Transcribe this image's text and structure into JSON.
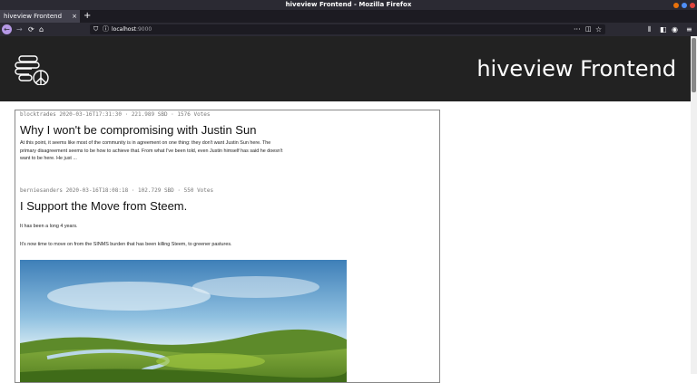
{
  "window": {
    "title": "hiveview Frontend - Mozilla Firefox"
  },
  "tab": {
    "label": "hiveview Frontend",
    "close": "×",
    "new_tab": "+"
  },
  "url_bar": {
    "host": "localhost",
    "port": ":9000"
  },
  "site": {
    "title": "hiveview Frontend"
  },
  "posts": [
    {
      "meta": "blocktrades 2020-03-16T17:31:30 · 221.989 SBD · 1576 Votes",
      "title": "Why I won't be compromising with Justin Sun",
      "excerpt": "At this point, it seems like most of the community is in agreement on one thing: they don't want Justin Sun here. The primary disagreement seems to be how to achieve that. From what I've been told, even Justin himself has said he doesn't want to be here. He just ..."
    },
    {
      "meta": "berniesanders 2020-03-16T18:08:18 · 102.729 SBD · 550 Votes",
      "title": "I Support the Move from Steem.",
      "line1": "It has been a long 4 years.",
      "line2": "It's now time to move on from the SINMS burden that has been killing Steem, to greener pastures."
    }
  ],
  "icons": [
    "back-icon",
    "forward-icon",
    "reload-icon",
    "home-icon",
    "shield-icon",
    "info-icon",
    "more-icon",
    "pocket-icon",
    "star-icon",
    "library-icon",
    "sidebar-icon",
    "account-icon",
    "extension-icon",
    "menu-icon",
    "logo-icon"
  ]
}
